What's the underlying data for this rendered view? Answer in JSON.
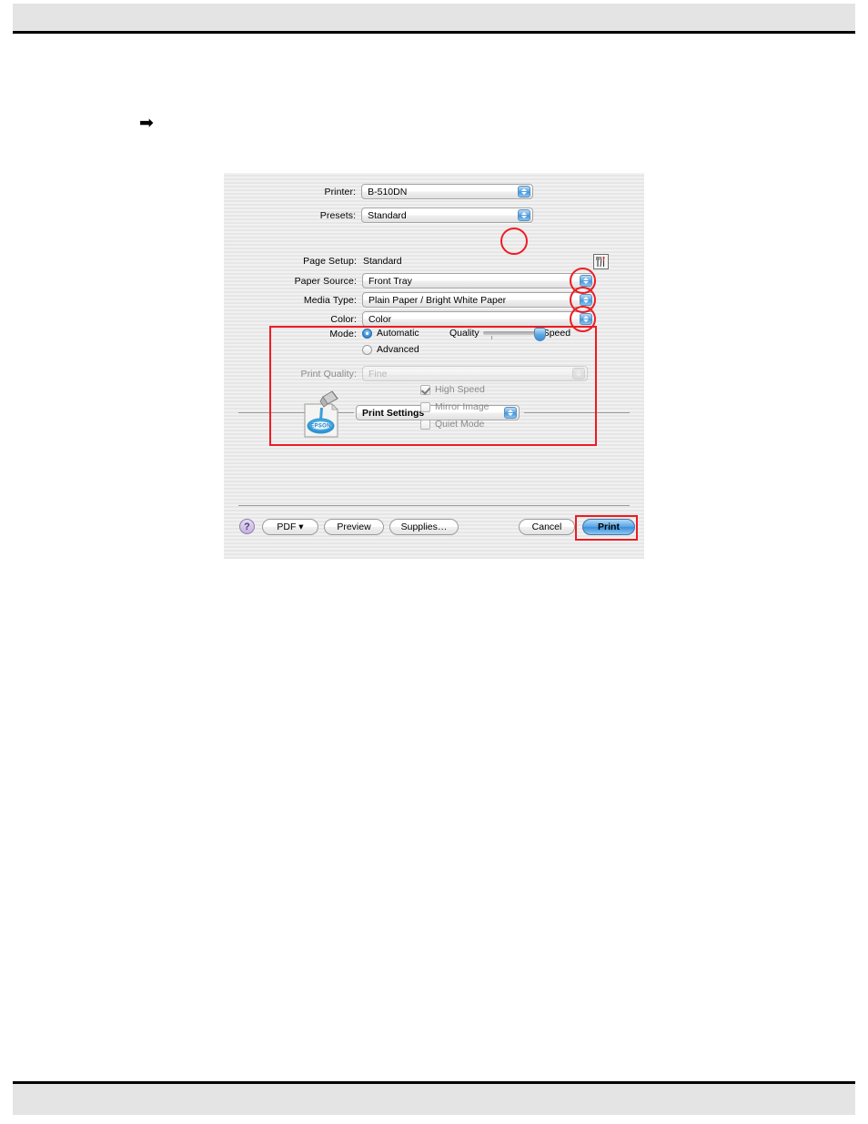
{
  "page": {
    "arrow_bullet": "➡"
  },
  "dialog": {
    "printer": {
      "label": "Printer:",
      "value": "B-510DN"
    },
    "presets": {
      "label": "Presets:",
      "value": "Standard"
    },
    "pane": {
      "value": "Print Settings"
    },
    "page_setup": {
      "label": "Page Setup:",
      "value": "Standard"
    },
    "paper_source": {
      "label": "Paper Source:",
      "value": "Front Tray"
    },
    "media_type": {
      "label": "Media Type:",
      "value": "Plain Paper / Bright White Paper"
    },
    "color": {
      "label": "Color:",
      "value": "Color"
    },
    "mode": {
      "label": "Mode:",
      "automatic": "Automatic",
      "advanced": "Advanced",
      "selected": "Automatic"
    },
    "slider": {
      "left_label": "Quality",
      "right_label": "Speed",
      "position": "Speed"
    },
    "print_quality": {
      "label": "Print Quality:",
      "value": "Fine",
      "enabled": false
    },
    "checkboxes": [
      {
        "label": "High Speed",
        "checked": true,
        "enabled": false
      },
      {
        "label": "Mirror Image",
        "checked": false,
        "enabled": false
      },
      {
        "label": "Quiet Mode",
        "checked": false,
        "enabled": false
      }
    ],
    "buttons": {
      "help": "?",
      "pdf": "PDF ▾",
      "preview": "Preview",
      "supplies": "Supplies…",
      "cancel": "Cancel",
      "print": "Print"
    },
    "icons": {
      "utility": "printer-utility-icon",
      "epson": "epson-ink-icon"
    }
  },
  "annotations": {
    "accent_color": "#ec1c24",
    "circles": [
      "pane-popup-arrows",
      "paper-source-arrows",
      "media-type-arrows",
      "color-arrows"
    ],
    "rects": [
      "mode-section",
      "print-button"
    ]
  }
}
